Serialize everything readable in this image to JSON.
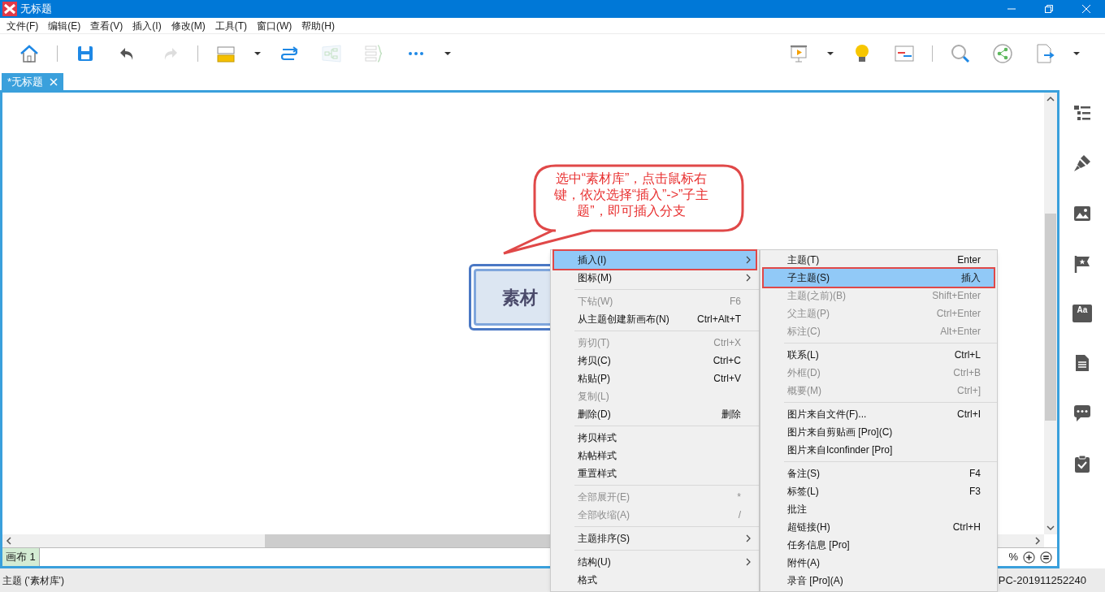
{
  "window": {
    "title": "无标题"
  },
  "menu_bar": [
    "文件(F)",
    "编辑(E)",
    "查看(V)",
    "插入(I)",
    "修改(M)",
    "工具(T)",
    "窗口(W)",
    "帮助(H)"
  ],
  "toolbar_left": [
    {
      "kind": "home",
      "disabled": false
    },
    {
      "kind": "sep"
    },
    {
      "kind": "save",
      "disabled": false
    },
    {
      "kind": "undo",
      "disabled": false
    },
    {
      "kind": "redo",
      "disabled": true
    },
    {
      "kind": "sep"
    },
    {
      "kind": "topic",
      "disabled": false
    },
    {
      "kind": "dropdown",
      "disabled": false
    },
    {
      "kind": "relationship",
      "disabled": false
    },
    {
      "kind": "boundary",
      "disabled": true
    },
    {
      "kind": "summary",
      "disabled": true
    },
    {
      "kind": "more",
      "disabled": false
    },
    {
      "kind": "dropdown",
      "disabled": false
    }
  ],
  "toolbar_right": [
    {
      "kind": "presentation",
      "disabled": false
    },
    {
      "kind": "dropdown",
      "disabled": false
    },
    {
      "kind": "bulb",
      "disabled": false
    },
    {
      "kind": "gantt",
      "disabled": false
    },
    {
      "kind": "sep"
    },
    {
      "kind": "search",
      "disabled": false
    },
    {
      "kind": "share",
      "disabled": false
    },
    {
      "kind": "export",
      "disabled": false
    },
    {
      "kind": "dropdown",
      "disabled": false
    }
  ],
  "doc_tabs": [
    {
      "label": "*无标题",
      "selected": true
    }
  ],
  "canvas": {
    "topic": "素材",
    "callout": "选中“素材库”，点击鼠标右键，依次选择“插入”->”子主题”，即可插入分支"
  },
  "sheet_tabs": [
    {
      "label": "画布 1",
      "selected": true
    }
  ],
  "zoom_text": "%",
  "sidebar": [
    {
      "kind": "outline"
    },
    {
      "kind": "brush"
    },
    {
      "kind": "image"
    },
    {
      "kind": "flag"
    },
    {
      "kind": "text",
      "label": "Aa"
    },
    {
      "kind": "document"
    },
    {
      "kind": "comment"
    },
    {
      "kind": "task"
    }
  ],
  "status_bar": {
    "left": "主题 ('素材库')",
    "right": "PC-201911252240"
  },
  "context_menu": [
    {
      "kind": "item",
      "label": "插入(I)",
      "submenu": true,
      "disabled": false,
      "selected": true
    },
    {
      "kind": "item",
      "label": "图标(M)",
      "submenu": true,
      "disabled": false,
      "selected": false
    },
    {
      "kind": "sep"
    },
    {
      "kind": "item",
      "label": "下钻(W)",
      "shortcut": "F6",
      "submenu": false,
      "disabled": true,
      "selected": false
    },
    {
      "kind": "item",
      "label": "从主题创建新画布(N)",
      "shortcut": "Ctrl+Alt+T",
      "submenu": false,
      "disabled": false,
      "selected": false
    },
    {
      "kind": "sep"
    },
    {
      "kind": "item",
      "label": "剪切(T)",
      "shortcut": "Ctrl+X",
      "submenu": false,
      "disabled": true,
      "selected": false
    },
    {
      "kind": "item",
      "label": "拷贝(C)",
      "shortcut": "Ctrl+C",
      "submenu": false,
      "disabled": false,
      "selected": false
    },
    {
      "kind": "item",
      "label": "粘贴(P)",
      "shortcut": "Ctrl+V",
      "submenu": false,
      "disabled": false,
      "selected": false
    },
    {
      "kind": "item",
      "label": "复制(L)",
      "submenu": false,
      "disabled": true,
      "selected": false
    },
    {
      "kind": "item",
      "label": "删除(D)",
      "shortcut": "删除",
      "submenu": false,
      "disabled": false,
      "selected": false
    },
    {
      "kind": "sep"
    },
    {
      "kind": "item",
      "label": "拷贝样式",
      "submenu": false,
      "disabled": false,
      "selected": false
    },
    {
      "kind": "item",
      "label": "粘帖样式",
      "submenu": false,
      "disabled": false,
      "selected": false
    },
    {
      "kind": "item",
      "label": "重置样式",
      "submenu": false,
      "disabled": false,
      "selected": false
    },
    {
      "kind": "sep"
    },
    {
      "kind": "item",
      "label": "全部展开(E)",
      "shortcut": "*",
      "submenu": false,
      "disabled": true,
      "selected": false
    },
    {
      "kind": "item",
      "label": "全部收缩(A)",
      "shortcut": "/",
      "submenu": false,
      "disabled": true,
      "selected": false
    },
    {
      "kind": "sep"
    },
    {
      "kind": "item",
      "label": "主题排序(S)",
      "submenu": true,
      "disabled": false,
      "selected": false
    },
    {
      "kind": "sep"
    },
    {
      "kind": "item",
      "label": "结构(U)",
      "submenu": true,
      "disabled": false,
      "selected": false
    },
    {
      "kind": "item",
      "label": "格式",
      "submenu": false,
      "disabled": false,
      "selected": false
    }
  ],
  "submenu": [
    {
      "kind": "item",
      "label": "主题(T)",
      "shortcut": "Enter",
      "disabled": false,
      "selected": false
    },
    {
      "kind": "item",
      "label": "子主题(S)",
      "shortcut": "插入",
      "disabled": false,
      "selected": true
    },
    {
      "kind": "item",
      "label": "主题(之前)(B)",
      "shortcut": "Shift+Enter",
      "disabled": true,
      "selected": false
    },
    {
      "kind": "item",
      "label": "父主题(P)",
      "shortcut": "Ctrl+Enter",
      "disabled": true,
      "selected": false
    },
    {
      "kind": "item",
      "label": "标注(C)",
      "shortcut": "Alt+Enter",
      "disabled": true,
      "selected": false
    },
    {
      "kind": "sep"
    },
    {
      "kind": "item",
      "label": "联系(L)",
      "shortcut": "Ctrl+L",
      "disabled": false,
      "selected": false
    },
    {
      "kind": "item",
      "label": "外框(D)",
      "shortcut": "Ctrl+B",
      "disabled": true,
      "selected": false
    },
    {
      "kind": "item",
      "label": "概要(M)",
      "shortcut": "Ctrl+]",
      "disabled": true,
      "selected": false
    },
    {
      "kind": "sep"
    },
    {
      "kind": "item",
      "label": "图片来自文件(F)...",
      "shortcut": "Ctrl+I",
      "disabled": false,
      "selected": false
    },
    {
      "kind": "item",
      "label": "图片来自剪贴画 [Pro](C)",
      "disabled": false,
      "selected": false
    },
    {
      "kind": "item",
      "label": "图片来自Iconfinder [Pro]",
      "disabled": false,
      "selected": false
    },
    {
      "kind": "sep"
    },
    {
      "kind": "item",
      "label": "备注(S)",
      "shortcut": "F4",
      "disabled": false,
      "selected": false
    },
    {
      "kind": "item",
      "label": "标签(L)",
      "shortcut": "F3",
      "disabled": false,
      "selected": false
    },
    {
      "kind": "item",
      "label": "批注",
      "disabled": false,
      "selected": false
    },
    {
      "kind": "item",
      "label": "超链接(H)",
      "shortcut": "Ctrl+H",
      "disabled": false,
      "selected": false
    },
    {
      "kind": "item",
      "label": "任务信息 [Pro]",
      "disabled": false,
      "selected": false
    },
    {
      "kind": "item",
      "label": "附件(A)",
      "disabled": false,
      "selected": false
    },
    {
      "kind": "item",
      "label": "录音 [Pro](A)",
      "disabled": false,
      "selected": false
    }
  ]
}
